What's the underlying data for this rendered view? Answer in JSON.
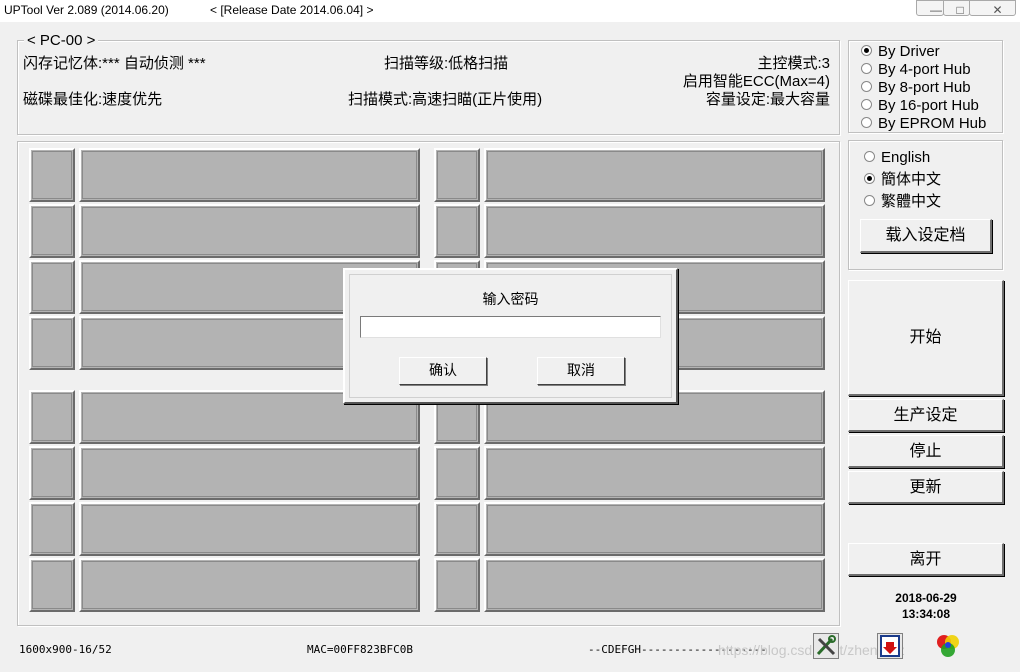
{
  "window": {
    "title": "UPTool Ver 2.089 (2014.06.20)",
    "release": "< [Release Date 2014.06.04] >",
    "min_glyph": "—",
    "max_glyph": "□",
    "close_glyph": "✕"
  },
  "info": {
    "group_label": "< PC-00 >",
    "flash_memory": "闪存记忆体:*** 自动侦测 ***",
    "scan_level": "扫描等级:低格扫描",
    "controller_mode": "主控模式:3",
    "smart_ecc": "启用智能ECC(Max=4)",
    "disk_optimize": "磁碟最佳化:速度优先",
    "scan_mode": "扫描模式:高速扫瞄(正片使用)",
    "capacity": "容量设定:最大容量"
  },
  "port_options": [
    {
      "label": "By Driver",
      "selected": true
    },
    {
      "label": "By 4-port Hub",
      "selected": false
    },
    {
      "label": "By 8-port Hub",
      "selected": false
    },
    {
      "label": "By 16-port Hub",
      "selected": false
    },
    {
      "label": "By EPROM Hub",
      "selected": false
    }
  ],
  "language_options": [
    {
      "label": "English",
      "selected": false
    },
    {
      "label": "簡体中文",
      "selected": true
    },
    {
      "label": "繁體中文",
      "selected": false
    }
  ],
  "buttons": {
    "load_config": "载入设定档",
    "start": "开始",
    "production": "生产设定",
    "stop": "停止",
    "update": "更新",
    "exit": "离开"
  },
  "datetime": {
    "date": "2018-06-29",
    "time": "13:34:08"
  },
  "dialog": {
    "title": "输入密码",
    "password_value": "",
    "ok": "确认",
    "cancel": "取消"
  },
  "status": {
    "resolution": "1600x900-16/52",
    "mac": "MAC=00FF823BFC0B",
    "drives": "--CDEFGH-------------------"
  },
  "watermark": "https://blog.csdn.net/zhengrez",
  "icons": [
    "tools-icon",
    "download-icon",
    "color-circles-icon"
  ]
}
